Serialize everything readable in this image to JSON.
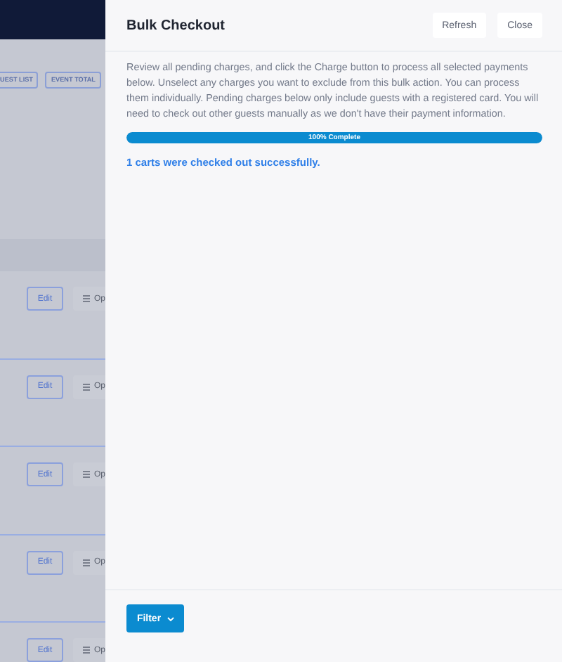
{
  "background": {
    "toolbar_buttons": [
      "UEST LIST",
      "EVENT TOTAL"
    ],
    "rows": [
      {
        "edit": "Edit",
        "options": "Op"
      },
      {
        "edit": "Edit",
        "options": "Op"
      },
      {
        "edit": "Edit",
        "options": "Op"
      },
      {
        "edit": "Edit",
        "options": "Op"
      },
      {
        "edit": "Edit",
        "options": "Op"
      }
    ]
  },
  "drawer": {
    "title": "Bulk Checkout",
    "buttons": [
      "Refresh",
      "Close"
    ],
    "description": "Review all pending charges, and click the Charge button to process all selected payments below. Unselect any charges you want to exclude from this bulk action. You can process them individually. Pending charges below only include guests with a registered card. You will need to check out other guests manually as we don't have their payment information.",
    "progress": {
      "level": 1,
      "label": "100% Complete"
    },
    "message": "1 carts were checked out successfully.",
    "filter_button": "Filter"
  }
}
